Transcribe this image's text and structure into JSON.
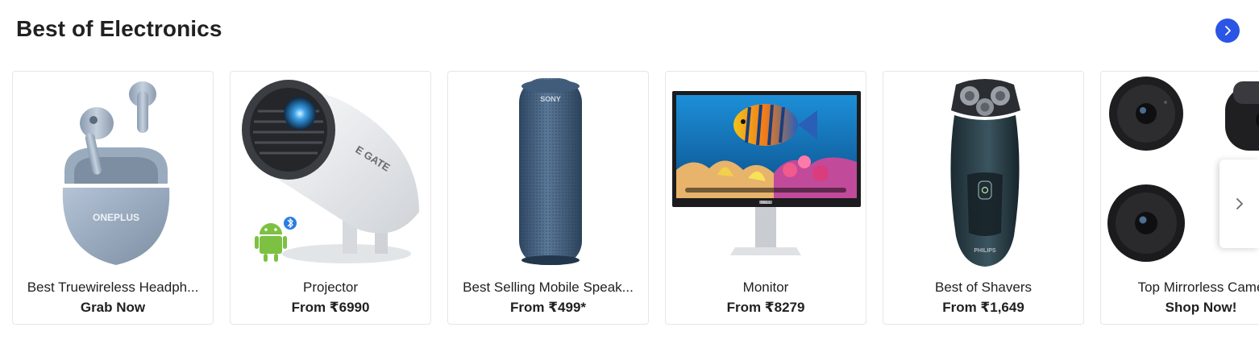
{
  "section": {
    "title": "Best of Electronics",
    "view_all_icon": "chevron-right-icon",
    "accent_color": "#2a55e5"
  },
  "carousel": {
    "next_icon": "chevron-right-icon",
    "items": [
      {
        "label": "Best Truewireless Headph...",
        "sub": "Grab Now",
        "image": "earbuds-image",
        "brand_print": "ONEPLUS"
      },
      {
        "label": "Projector",
        "sub": "From ₹6990",
        "image": "projector-image",
        "brand_print": "E GATE"
      },
      {
        "label": "Best Selling Mobile Speak...",
        "sub": "From ₹499*",
        "image": "speaker-image",
        "brand_print": "SONY"
      },
      {
        "label": "Monitor",
        "sub": "From ₹8279",
        "image": "monitor-image",
        "brand_print": "DELL"
      },
      {
        "label": "Best of Shavers",
        "sub": "From ₹1,649",
        "image": "shaver-image",
        "brand_print": "PHILIPS"
      },
      {
        "label": "Top Mirrorless Came",
        "sub": "Shop Now!",
        "image": "camera-image"
      }
    ]
  }
}
